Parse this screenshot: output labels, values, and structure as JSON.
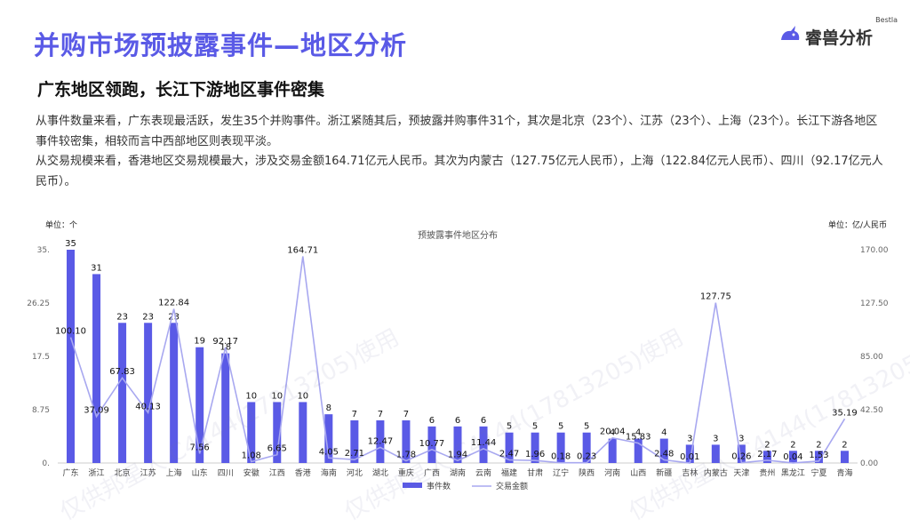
{
  "header": {
    "title": "并购市场预披露事件—地区分析",
    "logo_small": "Bestla",
    "logo_text": "睿兽分析"
  },
  "subtitle": "广东地区领跑，长江下游地区事件密集",
  "paragraphs": {
    "p1": "从事件数量来看，广东表现最活跃，发生35个并购事件。浙江紧随其后，预披露并购事件31个，其次是北京（23个）、江苏（23个）、上海（23个）。长江下游各地区事件较密集，相较而言中西部地区则表现平淡。",
    "p2": "从交易规模来看，香港地区交易规模最大，涉及交易金额164.71亿元人民币。其次为内蒙古（127.75亿元人民币），上海（122.84亿元人民币）、四川（92.17亿元人民币）。"
  },
  "watermark": "仅供邦星人 C4144(17813205)使用",
  "chart_data": {
    "type": "bar",
    "title": "预披露事件地区分布",
    "left_unit": "单位：个",
    "right_unit": "单位：亿/人民币",
    "categories": [
      "广东",
      "浙江",
      "北京",
      "江苏",
      "上海",
      "山东",
      "四川",
      "安徽",
      "江西",
      "香港",
      "海南",
      "河北",
      "湖北",
      "重庆",
      "广西",
      "湖南",
      "云南",
      "福建",
      "甘肃",
      "辽宁",
      "陕西",
      "河南",
      "山西",
      "新疆",
      "吉林",
      "内蒙古",
      "天津",
      "贵州",
      "黑龙江",
      "宁夏",
      "青海"
    ],
    "series": [
      {
        "name": "事件数",
        "type": "bar",
        "axis": "left",
        "color": "#5a5ae6",
        "values": [
          35,
          31,
          23,
          23,
          23,
          19,
          18,
          10,
          10,
          10,
          8,
          7,
          7,
          7,
          6,
          6,
          6,
          5,
          5,
          5,
          5,
          4,
          4,
          4,
          3,
          3,
          3,
          2,
          2,
          2,
          2
        ]
      },
      {
        "name": "交易金额",
        "type": "line",
        "axis": "right",
        "color": "#a8a8f0",
        "values": [
          100.1,
          37.09,
          67.83,
          40.13,
          122.84,
          7.56,
          92.17,
          1.08,
          6.65,
          164.71,
          4.05,
          2.71,
          12.47,
          1.78,
          10.77,
          1.94,
          11.44,
          2.47,
          1.96,
          0.18,
          0.23,
          20.04,
          15.83,
          2.48,
          0.01,
          127.75,
          0.26,
          2.17,
          0.04,
          1.53,
          35.19
        ]
      }
    ],
    "left_axis": {
      "ylim": [
        0,
        35
      ],
      "ticks": [
        "0.",
        "8.75",
        "17.5",
        "26.25",
        "35."
      ]
    },
    "right_axis": {
      "ylim": [
        0,
        170
      ],
      "ticks": [
        "0.00",
        "42.50",
        "85.00",
        "127.50",
        "170.00"
      ]
    },
    "legend_position": "bottom"
  }
}
